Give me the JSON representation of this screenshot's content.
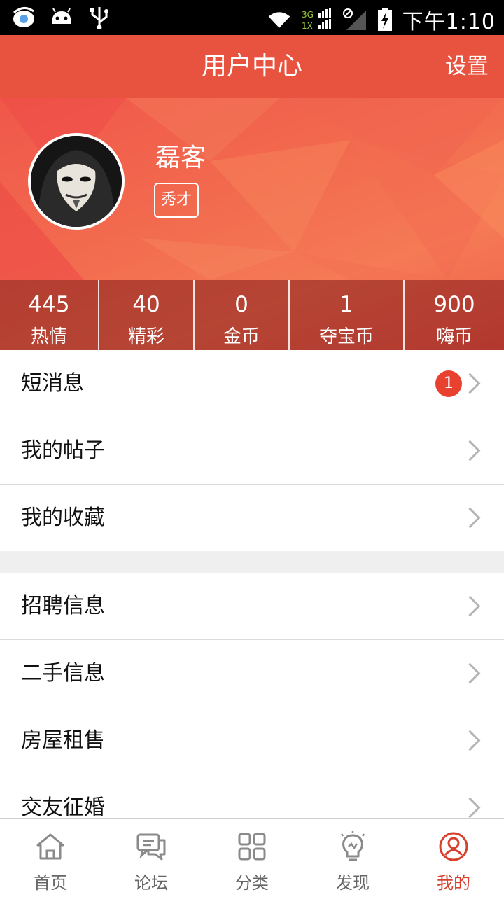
{
  "status_bar": {
    "network": [
      "3G",
      "1X"
    ],
    "time": "下午1:10"
  },
  "header": {
    "title": "用户中心",
    "settings_label": "设置"
  },
  "profile": {
    "username": "磊客",
    "rank": "秀才",
    "stats": [
      {
        "value": "445",
        "label": "热情"
      },
      {
        "value": "40",
        "label": "精彩"
      },
      {
        "value": "0",
        "label": "金币"
      },
      {
        "value": "1",
        "label": "夺宝币"
      },
      {
        "value": "900",
        "label": "嗨币"
      }
    ]
  },
  "menu_group_1": [
    {
      "label": "短消息",
      "badge": "1"
    },
    {
      "label": "我的帖子"
    },
    {
      "label": "我的收藏"
    }
  ],
  "menu_group_2": [
    {
      "label": "招聘信息"
    },
    {
      "label": "二手信息"
    },
    {
      "label": "房屋租售"
    },
    {
      "label": "交友征婚"
    }
  ],
  "tabs": [
    {
      "label": "首页",
      "icon": "home-icon"
    },
    {
      "label": "论坛",
      "icon": "forum-icon"
    },
    {
      "label": "分类",
      "icon": "category-icon"
    },
    {
      "label": "发现",
      "icon": "discover-icon"
    },
    {
      "label": "我的",
      "icon": "profile-icon",
      "active": true
    }
  ],
  "colors": {
    "accent": "#e8533f",
    "tab_active": "#d8402e",
    "badge": "#e8412f"
  }
}
